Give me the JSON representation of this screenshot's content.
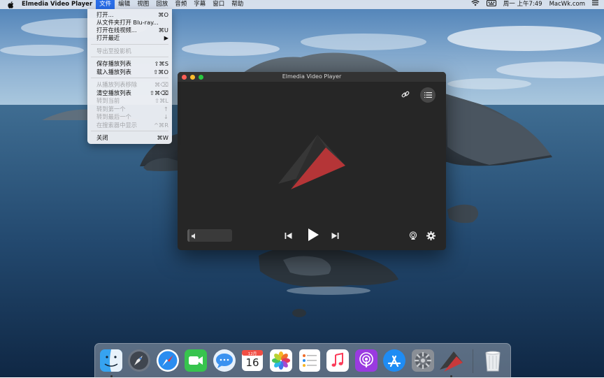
{
  "menubar": {
    "apple_icon": "apple-logo-icon",
    "app_name": "Elmedia Video Player",
    "menus": [
      "文件",
      "编辑",
      "视图",
      "回放",
      "音频",
      "字幕",
      "窗口",
      "帮助"
    ],
    "active_menu_index": 0,
    "status_icons": [
      "wifi-icon",
      "keyboard-input-icon"
    ],
    "clock": "周一 上午7:49",
    "site_text": "MacWk.com",
    "list_icon": "menu-list-icon"
  },
  "file_menu": {
    "items": [
      {
        "label": "打开...",
        "shortcut": "⌘O",
        "enabled": true
      },
      {
        "label": "从文件夹打开 Blu-ray...",
        "shortcut": "",
        "enabled": true
      },
      {
        "label": "打开在线视频...",
        "shortcut": "⌘U",
        "enabled": true
      },
      {
        "label": "打开最近",
        "shortcut": "▶",
        "enabled": true
      },
      {
        "label": "导出至投影机",
        "shortcut": "",
        "enabled": false
      },
      {
        "label": "保存播放列表",
        "shortcut": "⇧⌘S",
        "enabled": true
      },
      {
        "label": "载入播放列表",
        "shortcut": "⇧⌘O",
        "enabled": true
      },
      {
        "label": "从播放列表移除",
        "shortcut": "⌘⌫",
        "enabled": false
      },
      {
        "label": "清空播放列表",
        "shortcut": "⇧⌘⌫",
        "enabled": true
      },
      {
        "label": "转到当前",
        "shortcut": "⇧⌘L",
        "enabled": false
      },
      {
        "label": "转到第一个",
        "shortcut": "↑",
        "enabled": false
      },
      {
        "label": "转到最后一个",
        "shortcut": "↓",
        "enabled": false
      },
      {
        "label": "在搜索器中显示",
        "shortcut": "^⌘R",
        "enabled": false
      },
      {
        "label": "关闭",
        "shortcut": "⌘W",
        "enabled": true
      }
    ]
  },
  "player": {
    "title": "Elmedia Video Player",
    "volume_level": 0.05,
    "controls": [
      "link-icon",
      "playlist-icon",
      "volume-icon",
      "previous-icon",
      "play-icon",
      "next-icon",
      "airplay-icon",
      "settings-icon"
    ]
  },
  "dock": {
    "apps": [
      "Finder",
      "Launchpad",
      "Safari",
      "FaceTime",
      "Messages",
      "Calendar",
      "Photos",
      "Reminders",
      "Music",
      "Podcasts",
      "App Store",
      "System Preferences",
      "Elmedia Video Player",
      "Trash"
    ],
    "calendar_month": "12月",
    "calendar_day": "16"
  },
  "colors": {
    "menu_highlight": "#2a6ee8",
    "player_background": "#262626",
    "elmedia_red": "#c8393b",
    "close_light": "#fe5f57",
    "minimize_light": "#febc2e",
    "zoom_light": "#28c840"
  }
}
